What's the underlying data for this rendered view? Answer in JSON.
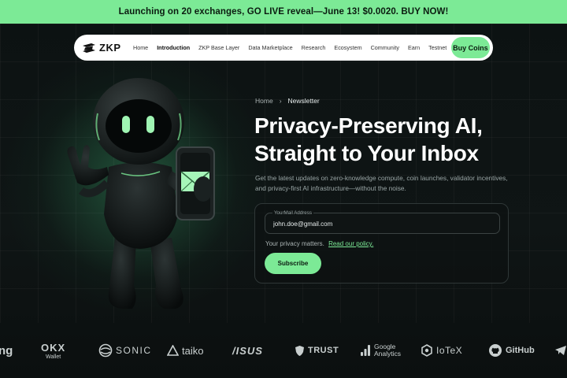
{
  "banner": {
    "text": "Launching on 20 exchanges, GO LIVE reveal—June 13! $0.0020. BUY NOW!"
  },
  "nav": {
    "logo": "ZKP",
    "items": [
      "Home",
      "Introduction",
      "ZKP Base Layer",
      "Data Marketplace",
      "Research",
      "Ecosystem",
      "Community",
      "Earn",
      "Testnet"
    ],
    "active": "Introduction",
    "cta": "Buy Coins"
  },
  "breadcrumb": {
    "home": "Home",
    "separator": "›",
    "current": "Newsletter"
  },
  "hero": {
    "title_line1": "Privacy-Preserving AI,",
    "title_line2": "Straight to Your Inbox",
    "subtitle": "Get the latest updates on zero-knowledge compute, coin launches, validator incentives, and privacy-first AI infrastructure—without the noise."
  },
  "form": {
    "field_label": "YourMail Address",
    "field_value": "john.doe@gmail.com",
    "privacy_text": "Your privacy matters.",
    "privacy_link": "Read our policy.",
    "submit": "Subscribe"
  },
  "partners": {
    "p0": "ng",
    "p1_top": "OKX",
    "p1_bottom": "Wallet",
    "p2": "SONIC",
    "p3": "taiko",
    "p4": "/ISUS",
    "p5": "TRUST",
    "p6_top": "Google",
    "p6_bottom": "Analytics",
    "p7": "IoTeX",
    "p8": "GitHub"
  },
  "colors": {
    "accent": "#7cea96",
    "background": "#0d1111",
    "nav_bg": "#ffffff"
  }
}
